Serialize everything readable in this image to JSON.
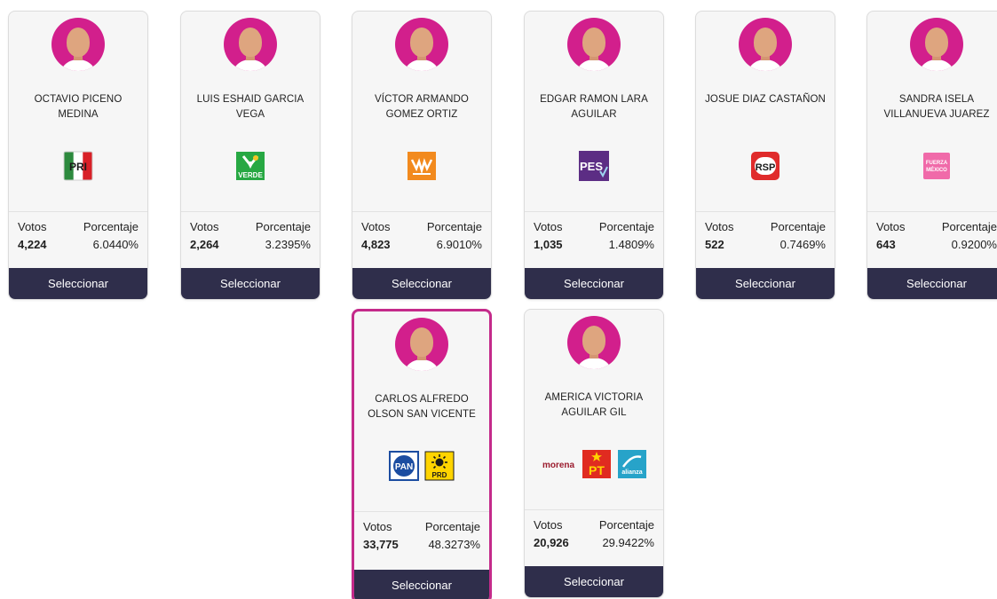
{
  "common": {
    "votes_label": "Votos",
    "percent_label": "Porcentaje",
    "select_label": "Seleccionar"
  },
  "colors": {
    "button": "#2f2e4b",
    "highlight": "#c42a8a",
    "avatar": "#d21f8c"
  },
  "candidates": [
    {
      "name": "OCTAVIO PICENO MEDINA",
      "parties": [
        "PRI"
      ],
      "votes": "4,224",
      "percent": "6.0440%",
      "selected": false
    },
    {
      "name": "LUIS ESHAID GARCIA VEGA",
      "parties": [
        "VERDE"
      ],
      "votes": "2,264",
      "percent": "3.2395%",
      "selected": false
    },
    {
      "name": "VÍCTOR ARMANDO GOMEZ ORTIZ",
      "parties": [
        "MOVIMIENTO CIUDADANO"
      ],
      "votes": "4,823",
      "percent": "6.9010%",
      "selected": false
    },
    {
      "name": "EDGAR RAMON LARA AGUILAR",
      "parties": [
        "PES"
      ],
      "votes": "1,035",
      "percent": "1.4809%",
      "selected": false
    },
    {
      "name": "JOSUE DIAZ CASTAÑON",
      "parties": [
        "RSP"
      ],
      "votes": "522",
      "percent": "0.7469%",
      "selected": false
    },
    {
      "name": "SANDRA ISELA VILLANUEVA JUAREZ",
      "parties": [
        "FUERZA MÉXICO"
      ],
      "votes": "643",
      "percent": "0.9200%",
      "selected": false
    },
    {
      "name": "CARLOS ALFREDO OLSON SAN VICENTE",
      "parties": [
        "PAN",
        "PRD"
      ],
      "votes": "33,775",
      "percent": "48.3273%",
      "selected": true
    },
    {
      "name": "AMERICA VICTORIA AGUILAR GIL",
      "parties": [
        "morena",
        "PT",
        "alianza"
      ],
      "votes": "20,926",
      "percent": "29.9422%",
      "selected": false
    }
  ]
}
